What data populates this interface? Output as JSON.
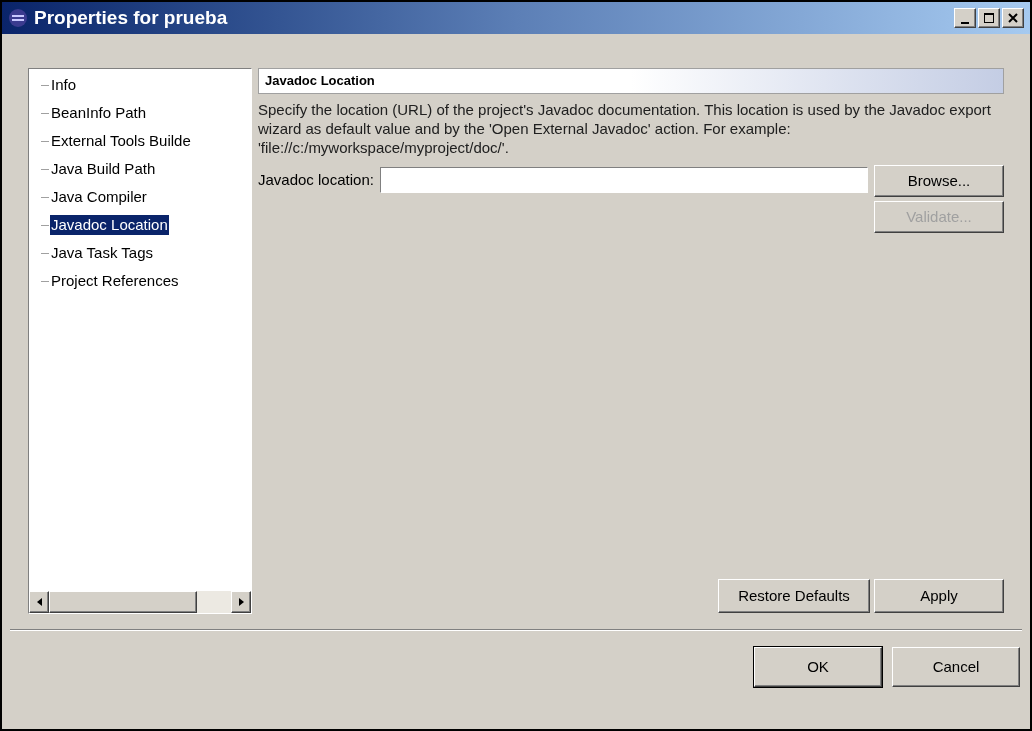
{
  "window": {
    "title": "Properties for prueba"
  },
  "tree": {
    "items": [
      {
        "label": "Info",
        "selected": false
      },
      {
        "label": "BeanInfo Path",
        "selected": false
      },
      {
        "label": "External Tools Builde",
        "selected": false
      },
      {
        "label": "Java Build Path",
        "selected": false
      },
      {
        "label": "Java Compiler",
        "selected": false
      },
      {
        "label": "Javadoc Location",
        "selected": true
      },
      {
        "label": "Java Task Tags",
        "selected": false
      },
      {
        "label": "Project References",
        "selected": false
      }
    ]
  },
  "page": {
    "title": "Javadoc Location",
    "description": "Specify the location (URL) of the project's Javadoc documentation. This location is used by the Javadoc export wizard as default value and by the 'Open External Javadoc' action. For example: 'file://c:/myworkspace/myproject/doc/'.",
    "field": {
      "label": "Javadoc location:"
    },
    "side_buttons": [
      {
        "label": "Browse...",
        "disabled": false
      },
      {
        "label": "Validate...",
        "disabled": true
      }
    ],
    "page_buttons": [
      {
        "label": "Restore Defaults",
        "disabled": false
      },
      {
        "label": "Apply",
        "disabled": false
      }
    ]
  },
  "dialog_buttons": [
    {
      "label": "OK",
      "default": true
    },
    {
      "label": "Cancel",
      "default": false
    }
  ]
}
